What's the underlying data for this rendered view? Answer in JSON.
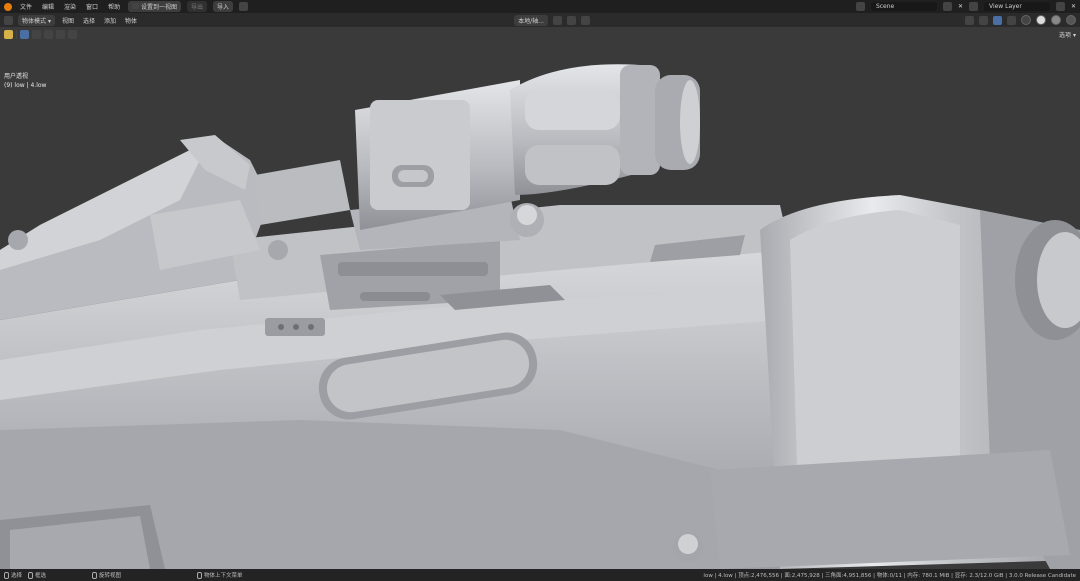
{
  "topbar": {
    "menus": [
      "文件",
      "编辑",
      "渲染",
      "窗口",
      "帮助"
    ],
    "workspace_tab": "设置到一视图",
    "import_dim": "导出",
    "import_label": "导入",
    "scene": "Scene",
    "view_layer": "View Layer"
  },
  "header": {
    "mode": "物体模式",
    "menus": [
      "视图",
      "选择",
      "添加",
      "物体"
    ],
    "transform": "本地/轴...",
    "options": "选项"
  },
  "viewport": {
    "view_name": "用户透视",
    "collection": "(9) low | 4.low"
  },
  "statusbar": {
    "select": "选择",
    "box": "框选",
    "rotate": "旋转视图",
    "context": "物体上下文菜单",
    "stats": "low | 4.low | 顶点:2,476,556 | 面:2,475,928 | 三角面:4,951,856 | 物体:0/11 | 内存: 780.1 MiB | 显存: 2.3/12.0 GiB | 3.0.0 Release Candidate"
  },
  "colors": {
    "background": "#3a3a3a",
    "model_base": "#b4b6bb",
    "model_light": "#e6e7ea",
    "model_dark": "#8e9096",
    "topbar": "#1f1f1f"
  }
}
